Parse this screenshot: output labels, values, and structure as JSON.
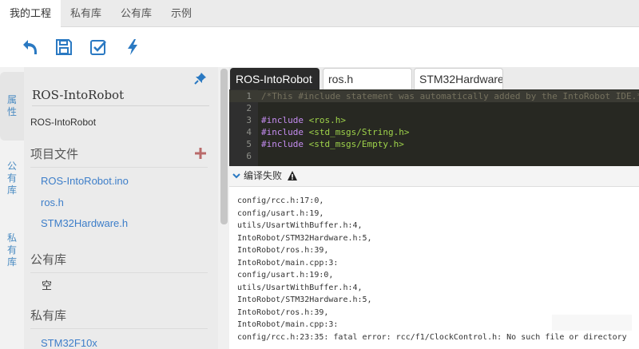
{
  "top_tabs": [
    "我的工程",
    "私有库",
    "公有库",
    "示例"
  ],
  "toolbar": {
    "icons": [
      "undo-icon",
      "save-icon",
      "verify-icon",
      "flash-icon"
    ],
    "accent": "#2a79c2"
  },
  "side_tabs": [
    "属性",
    "公有库",
    "私有库"
  ],
  "project": {
    "name": "ROS-IntoRobot",
    "subtitle": "ROS-IntoRobot"
  },
  "sections": {
    "files_title": "项目文件",
    "files": [
      "ROS-IntoRobot.ino",
      "ros.h",
      "STM32Hardware.h"
    ],
    "public_title": "公有库",
    "public_empty": "空",
    "private_title": "私有库",
    "private_items": [
      "STM32F10x"
    ]
  },
  "editor": {
    "tabs": [
      "ROS-IntoRobot",
      "ros.h",
      "STM32Hardware.h"
    ],
    "line_numbers": [
      "1",
      "2",
      "3",
      "4",
      "5",
      "6"
    ],
    "lines": [
      {
        "comment": "/*This #include statement was automatically added by the IntoRobot IDE.*/"
      },
      {},
      {
        "kw": "#include",
        "arg": "<ros.h>"
      },
      {
        "kw": "#include",
        "arg": "<std_msgs/String.h>"
      },
      {
        "kw": "#include",
        "arg": "<std_msgs/Empty.h>"
      },
      {}
    ]
  },
  "output": {
    "title": "编译失败",
    "lines": [
      "config/rcc.h:17:0,",
      "config/usart.h:19,",
      "utils/UsartWithBuffer.h:4,",
      "IntoRobot/STM32Hardware.h:5,",
      "IntoRobot/ros.h:39,",
      "IntoRobot/main.cpp:3:",
      "config/usart.h:19:0,",
      "utils/UsartWithBuffer.h:4,",
      "IntoRobot/STM32Hardware.h:5,",
      "IntoRobot/ros.h:39,",
      "IntoRobot/main.cpp:3:",
      "config/rcc.h:23:35: fatal error: rcc/f1/ClockControl.h: No such file or directory"
    ]
  },
  "watermark": "电子发烧友"
}
